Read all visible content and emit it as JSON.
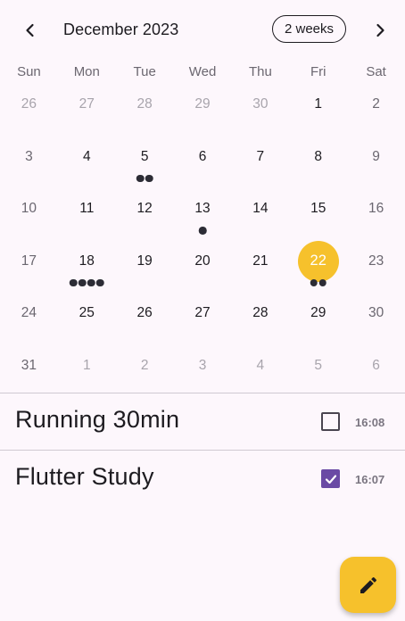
{
  "header": {
    "month_title": "December 2023",
    "format_button": "2 weeks"
  },
  "days_of_week": [
    "Sun",
    "Mon",
    "Tue",
    "Wed",
    "Thu",
    "Fri",
    "Sat"
  ],
  "weeks": [
    [
      {
        "d": "26",
        "muted": true
      },
      {
        "d": "27",
        "muted": true
      },
      {
        "d": "28",
        "muted": true
      },
      {
        "d": "29",
        "muted": true
      },
      {
        "d": "30",
        "muted": true
      },
      {
        "d": "1"
      },
      {
        "d": "2",
        "weekend": true
      }
    ],
    [
      {
        "d": "3",
        "weekend": true
      },
      {
        "d": "4"
      },
      {
        "d": "5",
        "markers": 2
      },
      {
        "d": "6"
      },
      {
        "d": "7"
      },
      {
        "d": "8"
      },
      {
        "d": "9",
        "weekend": true
      }
    ],
    [
      {
        "d": "10",
        "weekend": true
      },
      {
        "d": "11"
      },
      {
        "d": "12"
      },
      {
        "d": "13",
        "markers": 1
      },
      {
        "d": "14"
      },
      {
        "d": "15"
      },
      {
        "d": "16",
        "weekend": true
      }
    ],
    [
      {
        "d": "17",
        "weekend": true
      },
      {
        "d": "18",
        "markers": 4
      },
      {
        "d": "19"
      },
      {
        "d": "20"
      },
      {
        "d": "21"
      },
      {
        "d": "22",
        "selected": true,
        "markers": 2
      },
      {
        "d": "23",
        "weekend": true
      }
    ],
    [
      {
        "d": "24",
        "weekend": true
      },
      {
        "d": "25"
      },
      {
        "d": "26"
      },
      {
        "d": "27"
      },
      {
        "d": "28"
      },
      {
        "d": "29"
      },
      {
        "d": "30",
        "weekend": true
      }
    ],
    [
      {
        "d": "31",
        "weekend": true
      },
      {
        "d": "1",
        "muted": true
      },
      {
        "d": "2",
        "muted": true
      },
      {
        "d": "3",
        "muted": true
      },
      {
        "d": "4",
        "muted": true
      },
      {
        "d": "5",
        "muted": true
      },
      {
        "d": "6",
        "muted": true
      }
    ]
  ],
  "events": [
    {
      "title": "Running 30min",
      "time": "16:08",
      "done": false
    },
    {
      "title": "Flutter Study",
      "time": "16:07",
      "done": true
    }
  ],
  "colors": {
    "accent": "#f6c12c",
    "checkbox": "#6a4aa4",
    "background": "#fdf7fc"
  },
  "icons": {
    "prev": "chevron-left-icon",
    "next": "chevron-right-icon",
    "fab": "pencil-icon"
  }
}
